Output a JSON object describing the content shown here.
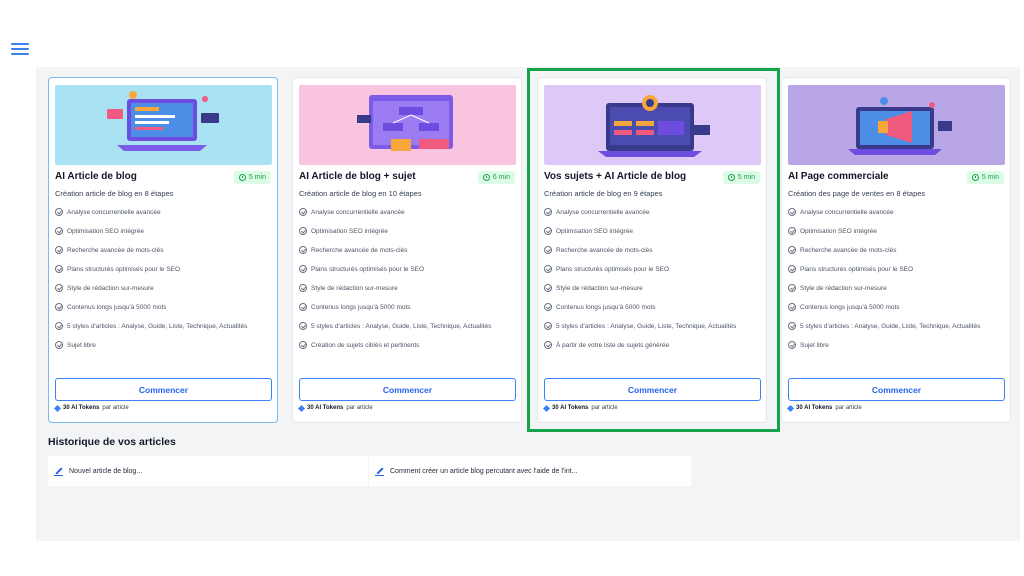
{
  "colors": {
    "accent": "#3b82f6",
    "highlight": "#16a34a"
  },
  "cards": [
    {
      "title": "AI Article de blog",
      "duration": "5 min",
      "subtitle": "Création article de blog en 8 étapes",
      "features": [
        "Analyse concurrentielle avancée",
        "Optimisation SEO intégrée",
        "Recherche avancée de mots-clés",
        "Plans structurés optimisés pour le SEO",
        "Style de rédaction sur-mesure",
        "Contenus longs jusqu'à 5000 mots",
        "5 styles d'articles : Analyse, Guide, Liste, Technique, Actualités",
        "Sujet libre"
      ],
      "cta": "Commencer",
      "tokens_bold": "30 AI Tokens",
      "tokens_rest": "par article",
      "hero_color": "#a9e2f3"
    },
    {
      "title": "AI Article de blog + sujet",
      "duration": "6 min",
      "subtitle": "Création article de blog en 10 étapes",
      "features": [
        "Analyse concurrentielle avancée",
        "Optimisation SEO intégrée",
        "Recherche avancée de mots-clés",
        "Plans structurés optimisés pour le SEO",
        "Style de rédaction sur-mesure",
        "Contenus longs jusqu'à 5000 mots",
        "5 styles d'articles : Analyse, Guide, Liste, Technique, Actualités",
        "Création de sujets ciblés et pertinents"
      ],
      "cta": "Commencer",
      "tokens_bold": "30 AI Tokens",
      "tokens_rest": "par article",
      "hero_color": "#f8c4df"
    },
    {
      "title": "Vos sujets + AI Article de blog",
      "duration": "5 min",
      "subtitle": "Création article de blog en 9 étapes",
      "features": [
        "Analyse concurrentielle avancée",
        "Optimisation SEO intégrée",
        "Recherche avancée de mots-clés",
        "Plans structurés optimisés pour le SEO",
        "Style de rédaction sur-mesure",
        "Contenus longs jusqu'à 5000 mots",
        "5 styles d'articles : Analyse, Guide, Liste, Technique, Actualités",
        "À partir de votre liste de sujets générée"
      ],
      "cta": "Commencer",
      "tokens_bold": "30 AI Tokens",
      "tokens_rest": "par article",
      "hero_color": "#ddc8f7"
    },
    {
      "title": "AI Page commerciale",
      "duration": "5 min",
      "subtitle": "Création des page de ventes en 8 étapes",
      "features": [
        "Analyse concurrentielle avancée",
        "Optimisation SEO intégrée",
        "Recherche avancée de mots-clés",
        "Plans structurés optimisés pour le SEO",
        "Style de rédaction sur-mesure",
        "Contenus longs jusqu'à 5000 mots",
        "5 styles d'articles : Analyse, Guide, Liste, Technique, Actualités",
        "Sujet libre"
      ],
      "cta": "Commencer",
      "tokens_bold": "30 AI Tokens",
      "tokens_rest": "par article",
      "hero_color": "#b8a6e6"
    }
  ],
  "history": {
    "title": "Historique de vos articles",
    "items": [
      "Nouvel article de blog...",
      "Comment créer un article blog percutant avec l'aide de l'int..."
    ]
  }
}
